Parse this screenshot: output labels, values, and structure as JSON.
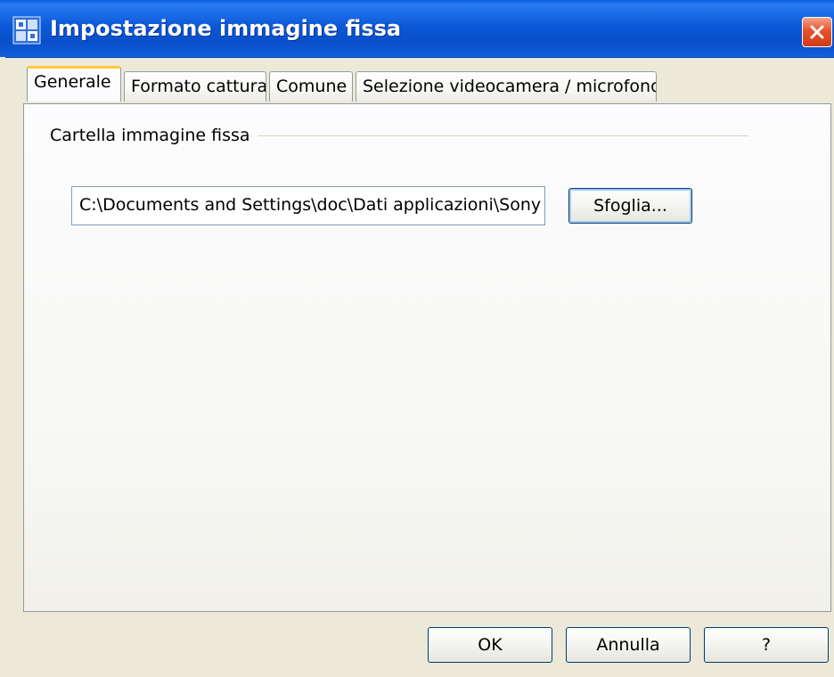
{
  "window": {
    "title": "Impostazione immagine fissa",
    "icon": "app-window-icon",
    "close_icon": "close-icon"
  },
  "tabs": [
    {
      "label": "Generale",
      "active": true
    },
    {
      "label": "Formato cattura",
      "active": false
    },
    {
      "label": "Comune",
      "active": false
    },
    {
      "label": "Selezione videocamera / microfono",
      "active": false
    }
  ],
  "general": {
    "group_label": "Cartella immagine fissa",
    "folder_path": "C:\\Documents and Settings\\doc\\Dati applicazioni\\Sony",
    "browse_label": "Sfoglia..."
  },
  "footer": {
    "ok_label": "OK",
    "cancel_label": "Annulla",
    "help_label": "?"
  },
  "colors": {
    "titlebar": "#0b58d8",
    "close_button": "#e6522c",
    "active_tab_accent": "#ffc83c",
    "dialog_background": "#ece9d8"
  }
}
